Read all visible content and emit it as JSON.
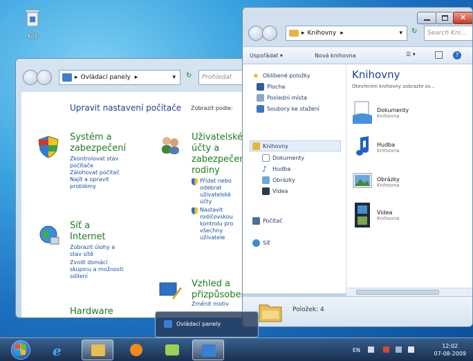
{
  "desktop": {
    "recycle_bin_label": "Koš"
  },
  "control_panel": {
    "address_crumb": "Ovládací panely",
    "search_placeholder": "Prohledat",
    "heading": "Upravit nastavení počítače",
    "view_by": "Zobrazit podle:",
    "categories": [
      {
        "title": "Systém a zabezpečení",
        "title_l1": "Systém a",
        "title_l2": "zabezpečení",
        "links": [
          "Zkontrolovat stav počítače",
          "Zálohovat počítač",
          "Najít a opravit problémy"
        ]
      },
      {
        "title_l1": "Uživatelské",
        "title_l2": "účty a",
        "title_l3": "zabezpečení",
        "title_l4": "rodiny",
        "links": [
          "Přidat nebo odebrat uživatelské účty",
          "Nastavit rodičovskou kontrolu pro všechny uživatele"
        ]
      },
      {
        "title_l1": "Síť a",
        "title_l2": "Internet",
        "links": [
          "Zobrazit úlohy a stav sítě",
          "Zvolit domácí skupinu a možnosti sdílení"
        ]
      },
      {
        "title_l1": "Vzhled a",
        "title_l2": "přizpůsobení",
        "links": [
          "Změnit motiv"
        ]
      },
      {
        "title_l1": "Hardware"
      }
    ]
  },
  "libraries": {
    "address_crumb": "Knihovny",
    "search_placeholder": "Search Kni...",
    "toolbar": {
      "organize": "Uspořádat ▾",
      "new_library": "Nová knihovna"
    },
    "nav": {
      "favorites": "Oblíbené položky",
      "desktop": "Plocha",
      "recent": "Poslední místa",
      "downloads": "Soubory ke stažení",
      "libraries": "Knihovny",
      "documents": "Dokumenty",
      "music": "Hudba",
      "pictures": "Obrázky",
      "videos": "Videa",
      "computer": "Počítač",
      "network": "Síť"
    },
    "title": "Knihovny",
    "subtitle": "Otevřením knihovny zobrazte sv...",
    "items": [
      {
        "name": "Dokumenty",
        "type": "Knihovna"
      },
      {
        "name": "Hudba",
        "type": "Knihovna"
      },
      {
        "name": "Obrázky",
        "type": "Knihovna"
      },
      {
        "name": "Videa",
        "type": "Knihovna"
      }
    ],
    "status": "Položek: 4"
  },
  "taskbar": {
    "thumbnail_label": "Ovládací panely",
    "language": "EN",
    "time": "12:02",
    "date": "07-08-2009"
  },
  "colors": {
    "link": "#1a4fa0",
    "category_title": "#1f7a1f",
    "heading": "#1d3f8c"
  }
}
